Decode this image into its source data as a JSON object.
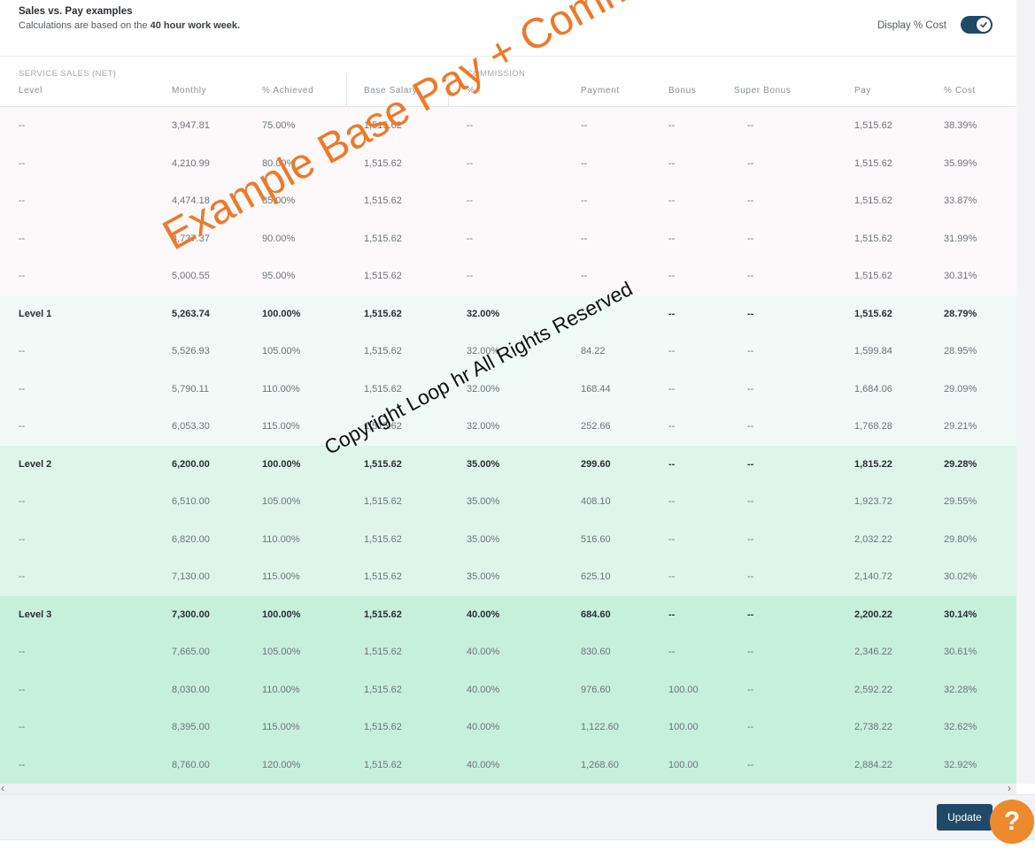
{
  "header": {
    "title": "Sales vs. Pay examples",
    "subtitle_prefix": "Calculations are based on the ",
    "subtitle_bold": "40 hour work week.",
    "toggle_label": "Display % Cost",
    "toggle_on": true
  },
  "table": {
    "groups": {
      "service_sales": "SERVICE SALES (NET)",
      "commission": "COMMISSION"
    },
    "columns": [
      "Level",
      "Monthly",
      "% Achieved",
      "Base Salary",
      "%",
      "Payment",
      "Bonus",
      "Super Bonus",
      "Pay",
      "% Cost"
    ],
    "rows": [
      {
        "level": "--",
        "monthly": "3,947.81",
        "achieved": "75.00%",
        "base": "1,515.62",
        "pct": "--",
        "payment": "--",
        "bonus": "--",
        "super_bonus": "--",
        "pay": "1,515.62",
        "cost": "38.39%",
        "bold": false,
        "bg": "#fdf9fa"
      },
      {
        "level": "--",
        "monthly": "4,210.99",
        "achieved": "80.00%",
        "base": "1,515.62",
        "pct": "--",
        "payment": "--",
        "bonus": "--",
        "super_bonus": "--",
        "pay": "1,515.62",
        "cost": "35.99%",
        "bold": false,
        "bg": "#fdf9fa"
      },
      {
        "level": "--",
        "monthly": "4,474.18",
        "achieved": "85.00%",
        "base": "1,515.62",
        "pct": "--",
        "payment": "--",
        "bonus": "--",
        "super_bonus": "--",
        "pay": "1,515.62",
        "cost": "33.87%",
        "bold": false,
        "bg": "#fdf9fa"
      },
      {
        "level": "--",
        "monthly": "4,737.37",
        "achieved": "90.00%",
        "base": "1,515.62",
        "pct": "--",
        "payment": "--",
        "bonus": "--",
        "super_bonus": "--",
        "pay": "1,515.62",
        "cost": "31.99%",
        "bold": false,
        "bg": "#fdf9fa"
      },
      {
        "level": "--",
        "monthly": "5,000.55",
        "achieved": "95.00%",
        "base": "1,515.62",
        "pct": "--",
        "payment": "--",
        "bonus": "--",
        "super_bonus": "--",
        "pay": "1,515.62",
        "cost": "30.31%",
        "bold": false,
        "bg": "#fdf9fa"
      },
      {
        "level": "Level 1",
        "monthly": "5,263.74",
        "achieved": "100.00%",
        "base": "1,515.62",
        "pct": "32.00%",
        "payment": "",
        "bonus": "--",
        "super_bonus": "--",
        "pay": "1,515.62",
        "cost": "28.79%",
        "bold": true,
        "bg": "#f0faf6"
      },
      {
        "level": "--",
        "monthly": "5,526.93",
        "achieved": "105.00%",
        "base": "1,515.62",
        "pct": "32.00%",
        "payment": "84.22",
        "bonus": "--",
        "super_bonus": "--",
        "pay": "1,599.84",
        "cost": "28.95%",
        "bold": false,
        "bg": "#f0faf6"
      },
      {
        "level": "--",
        "monthly": "5,790.11",
        "achieved": "110.00%",
        "base": "1,515.62",
        "pct": "32.00%",
        "payment": "168.44",
        "bonus": "--",
        "super_bonus": "--",
        "pay": "1,684.06",
        "cost": "29.09%",
        "bold": false,
        "bg": "#f0faf6"
      },
      {
        "level": "--",
        "monthly": "6,053.30",
        "achieved": "115.00%",
        "base": "1,515.62",
        "pct": "32.00%",
        "payment": "252.66",
        "bonus": "--",
        "super_bonus": "--",
        "pay": "1,768.28",
        "cost": "29.21%",
        "bold": false,
        "bg": "#f0faf6"
      },
      {
        "level": "Level 2",
        "monthly": "6,200.00",
        "achieved": "100.00%",
        "base": "1,515.62",
        "pct": "35.00%",
        "payment": "299.60",
        "bonus": "--",
        "super_bonus": "--",
        "pay": "1,815.22",
        "cost": "29.28%",
        "bold": true,
        "bg": "#dff5ec"
      },
      {
        "level": "--",
        "monthly": "6,510.00",
        "achieved": "105.00%",
        "base": "1,515.62",
        "pct": "35.00%",
        "payment": "408.10",
        "bonus": "--",
        "super_bonus": "--",
        "pay": "1,923.72",
        "cost": "29.55%",
        "bold": false,
        "bg": "#dff5ec"
      },
      {
        "level": "--",
        "monthly": "6,820.00",
        "achieved": "110.00%",
        "base": "1,515.62",
        "pct": "35.00%",
        "payment": "516.60",
        "bonus": "--",
        "super_bonus": "--",
        "pay": "2,032.22",
        "cost": "29.80%",
        "bold": false,
        "bg": "#dff5ec"
      },
      {
        "level": "--",
        "monthly": "7,130.00",
        "achieved": "115.00%",
        "base": "1,515.62",
        "pct": "35.00%",
        "payment": "625.10",
        "bonus": "--",
        "super_bonus": "--",
        "pay": "2,140.72",
        "cost": "30.02%",
        "bold": false,
        "bg": "#dff5ec"
      },
      {
        "level": "Level 3",
        "monthly": "7,300.00",
        "achieved": "100.00%",
        "base": "1,515.62",
        "pct": "40.00%",
        "payment": "684.60",
        "bonus": "--",
        "super_bonus": "--",
        "pay": "2,200.22",
        "cost": "30.14%",
        "bold": true,
        "bg": "#c6f0dc"
      },
      {
        "level": "--",
        "monthly": "7,665.00",
        "achieved": "105.00%",
        "base": "1,515.62",
        "pct": "40.00%",
        "payment": "830.60",
        "bonus": "--",
        "super_bonus": "--",
        "pay": "2,346.22",
        "cost": "30.61%",
        "bold": false,
        "bg": "#c6f0dc"
      },
      {
        "level": "--",
        "monthly": "8,030.00",
        "achieved": "110.00%",
        "base": "1,515.62",
        "pct": "40.00%",
        "payment": "976.60",
        "bonus": "100.00",
        "super_bonus": "--",
        "pay": "2,592.22",
        "cost": "32.28%",
        "bold": false,
        "bg": "#c6f0dc"
      },
      {
        "level": "--",
        "monthly": "8,395.00",
        "achieved": "115.00%",
        "base": "1,515.62",
        "pct": "40.00%",
        "payment": "1,122.60",
        "bonus": "100.00",
        "super_bonus": "--",
        "pay": "2,738.22",
        "cost": "32.62%",
        "bold": false,
        "bg": "#c6f0dc"
      },
      {
        "level": "--",
        "monthly": "8,760.00",
        "achieved": "120.00%",
        "base": "1,515.62",
        "pct": "40.00%",
        "payment": "1,268.60",
        "bonus": "100.00",
        "super_bonus": "--",
        "pay": "2,884.22",
        "cost": "32.92%",
        "bold": false,
        "bg": "#c6f0dc"
      }
    ]
  },
  "watermark": {
    "main": "Example Base Pay + Commission",
    "copyright": "Copyright Loop hr All Rights Reserved"
  },
  "scroll": {
    "left_arrow": "‹",
    "right_arrow": "›"
  },
  "footer": {
    "update_label": "Update",
    "help_label": "?"
  },
  "colors": {
    "brand": "#1f4968",
    "help": "#ec8a2c",
    "watermark": "#ec7a2a"
  }
}
